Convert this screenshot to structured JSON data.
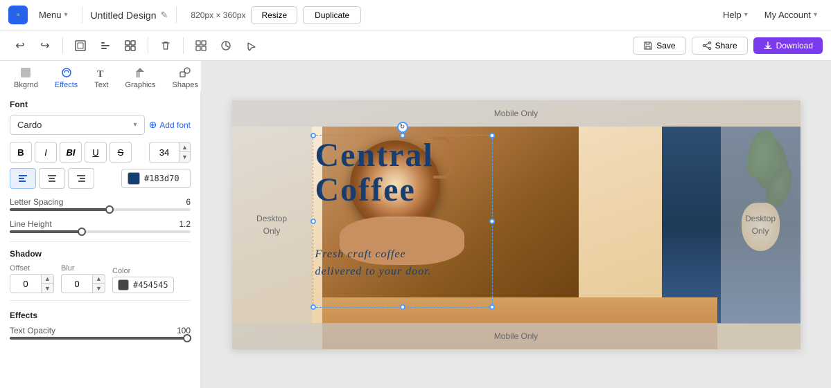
{
  "topNav": {
    "menu_label": "Menu",
    "title": "Untitled Design",
    "edit_icon": "✎",
    "dimensions": "820px × 360px",
    "resize_label": "Resize",
    "duplicate_label": "Duplicate",
    "help_label": "Help",
    "account_label": "My Account"
  },
  "toolbar": {
    "undo_label": "Undo",
    "redo_label": "Redo",
    "frame_label": "Frame",
    "align_label": "Align",
    "group_label": "Group",
    "delete_label": "Delete",
    "layout_label": "Layout",
    "animate_label": "Animate",
    "interact_label": "Interact",
    "save_label": "Save",
    "share_label": "Share",
    "download_label": "Download"
  },
  "sideTools": {
    "items": [
      {
        "id": "bkgrnd",
        "label": "Bkgrnd"
      },
      {
        "id": "effects",
        "label": "Effects"
      },
      {
        "id": "text",
        "label": "Text"
      },
      {
        "id": "graphics",
        "label": "Graphics"
      },
      {
        "id": "shapes",
        "label": "Shapes"
      }
    ],
    "active": "effects"
  },
  "fontPanel": {
    "section_title": "Font",
    "font_name": "Cardo",
    "add_font_label": "Add font",
    "font_size": "34",
    "bold_label": "B",
    "italic_label": "I",
    "bold_italic_label": "BI",
    "underline_label": "U",
    "strikethrough_label": "S",
    "align_left_label": "≡",
    "align_center_label": "≡",
    "align_right_label": "≡",
    "color_hex": "#183d70",
    "color_display": "#183d70"
  },
  "letterSpacing": {
    "label": "Letter Spacing",
    "value": "6",
    "percent": 55
  },
  "lineHeight": {
    "label": "Line Height",
    "value": "1.2",
    "percent": 40
  },
  "shadow": {
    "section_title": "Shadow",
    "offset_label": "Offset",
    "blur_label": "Blur",
    "color_label": "Color",
    "offset_value": "0",
    "blur_value": "0",
    "color_hex": "#454545",
    "color_display": "#454545"
  },
  "effects": {
    "section_title": "Effects",
    "opacity_label": "Text Opacity",
    "opacity_value": "100",
    "opacity_percent": 98
  },
  "canvas": {
    "mobile_only_label": "Mobile Only",
    "desktop_only_label": "Desktop Only",
    "main_text_line1": "Central",
    "main_text_line2": "Coffee",
    "sub_text_line1": "Fresh  craft  coffee",
    "sub_text_line2": "delivered  to  your  door."
  }
}
